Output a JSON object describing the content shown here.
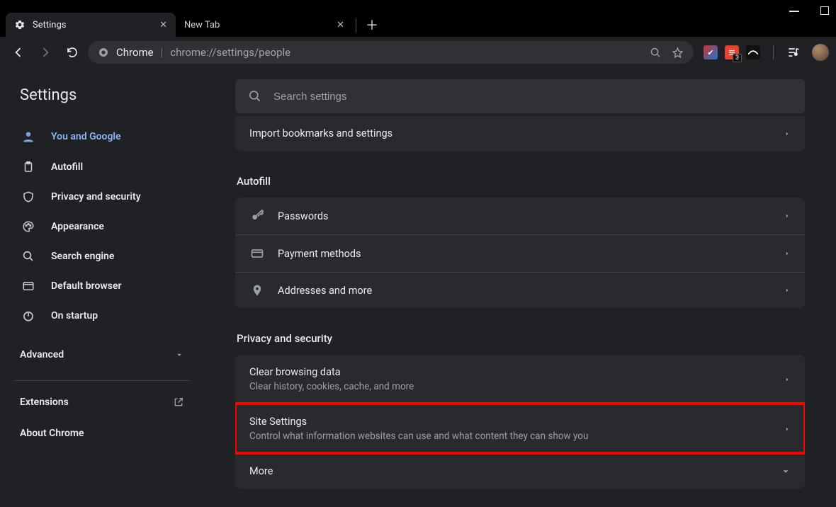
{
  "window": {
    "tabs": [
      {
        "title": "Settings",
        "active": true
      },
      {
        "title": "New Tab",
        "active": false
      }
    ]
  },
  "omnibox": {
    "scheme_label": "Chrome",
    "url_path": "chrome://settings/people"
  },
  "extensions_badge": "3",
  "sidebar": {
    "title": "Settings",
    "items": [
      {
        "label": "You and Google",
        "active": true
      },
      {
        "label": "Autofill",
        "active": false
      },
      {
        "label": "Privacy and security",
        "active": false
      },
      {
        "label": "Appearance",
        "active": false
      },
      {
        "label": "Search engine",
        "active": false
      },
      {
        "label": "Default browser",
        "active": false
      },
      {
        "label": "On startup",
        "active": false
      }
    ],
    "advanced_label": "Advanced",
    "extensions_label": "Extensions",
    "about_label": "About Chrome"
  },
  "search": {
    "placeholder": "Search settings"
  },
  "sections": {
    "top_row": {
      "label": "Import bookmarks and settings"
    },
    "autofill": {
      "title": "Autofill",
      "rows": [
        {
          "label": "Passwords"
        },
        {
          "label": "Payment methods"
        },
        {
          "label": "Addresses and more"
        }
      ]
    },
    "privacy": {
      "title": "Privacy and security",
      "rows": [
        {
          "label": "Clear browsing data",
          "sub": "Clear history, cookies, cache, and more"
        },
        {
          "label": "Site Settings",
          "sub": "Control what information websites can use and what content they can show you",
          "highlight": true
        },
        {
          "label": "More",
          "expand": true
        }
      ]
    }
  }
}
